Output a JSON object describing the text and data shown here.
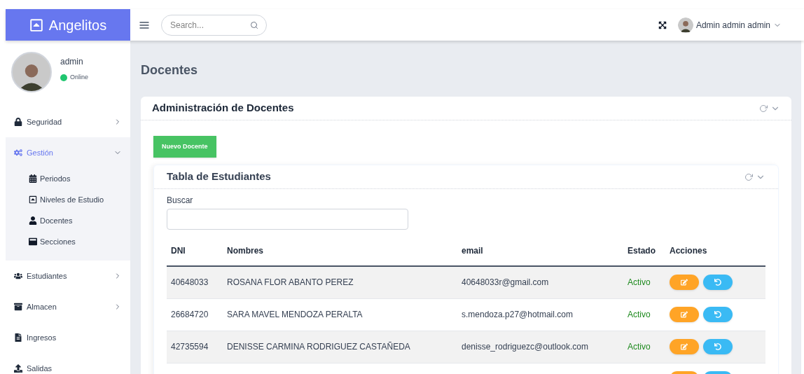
{
  "brand": {
    "name": "Angelitos"
  },
  "search": {
    "placeholder": "Search..."
  },
  "user_menu": {
    "name": "Admin admin admin"
  },
  "profile": {
    "name": "admin",
    "status": "Online",
    "online": true
  },
  "sidebar": {
    "items": [
      {
        "label": "Seguridad",
        "kind": "group",
        "expanded": false,
        "selected": false
      },
      {
        "label": "Gestión",
        "kind": "group",
        "expanded": true,
        "selected": true,
        "children": [
          {
            "label": "Periodos"
          },
          {
            "label": "Niveles de Estudio"
          },
          {
            "label": "Docentes"
          },
          {
            "label": "Secciones"
          }
        ]
      },
      {
        "label": "Estudiantes",
        "kind": "group",
        "expanded": false,
        "selected": false
      },
      {
        "label": "Almacen",
        "kind": "group",
        "expanded": false,
        "selected": false
      },
      {
        "label": "Ingresos",
        "kind": "link",
        "selected": false
      },
      {
        "label": "Salidas",
        "kind": "link",
        "selected": false
      }
    ]
  },
  "page_title": "Docentes",
  "card": {
    "title": "Administración de Docentes",
    "new_button": "Nuevo Docente",
    "table_card": {
      "title": "Tabla de Estudiantes",
      "search_label": "Buscar",
      "columns": [
        "DNI",
        "Nombres",
        "email",
        "Estado",
        "Acciones"
      ],
      "rows": [
        {
          "kind": "full",
          "dni": "40648033",
          "name": "ROSANA FLOR ABANTO PEREZ",
          "email": "40648033r@gmail.com",
          "status": "Activo",
          "active": true
        },
        {
          "kind": "full",
          "dni": "26684720",
          "name": "SARA MAVEL MENDOZA PERALTA",
          "email": "s.mendoza.p27@hotmail.com",
          "status": "Activo",
          "active": true
        },
        {
          "kind": "full",
          "dni": "42735594",
          "name": "DENISSE CARMINA RODRIGUEZ CASTAÑEDA",
          "email": "denisse_rodriguezc@outlook.com",
          "status": "Activo",
          "active": true
        },
        {
          "kind": "partial"
        }
      ]
    }
  }
}
